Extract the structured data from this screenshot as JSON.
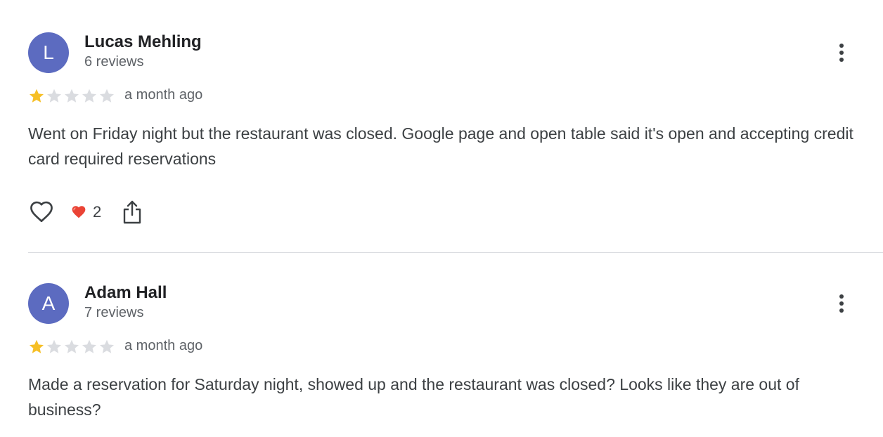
{
  "colors": {
    "avatar": "#5c6bc0",
    "star_filled": "#f6bf26",
    "star_empty": "#dadce0",
    "heart_reaction": "#ea4335",
    "divider": "#dadce0"
  },
  "reviews": [
    {
      "avatar_letter": "L",
      "author": "Lucas Mehling",
      "review_count": "6 reviews",
      "rating": 1,
      "max_rating": 5,
      "time_ago": "a month ago",
      "text": "Went on Friday night but the restaurant was closed. Google page and open table said it's open and accepting credit card required reservations",
      "reaction_count": "2",
      "icons": {
        "like": "heart-outline-icon",
        "reaction": "red-heart-icon",
        "share": "share-icon",
        "more": "more-vert-icon"
      }
    },
    {
      "avatar_letter": "A",
      "author": "Adam Hall",
      "review_count": "7 reviews",
      "rating": 1,
      "max_rating": 5,
      "time_ago": "a month ago",
      "text": "Made a reservation for Saturday night, showed up and the restaurant was closed? Looks like they are out of business?",
      "icons": {
        "more": "more-vert-icon"
      }
    }
  ]
}
